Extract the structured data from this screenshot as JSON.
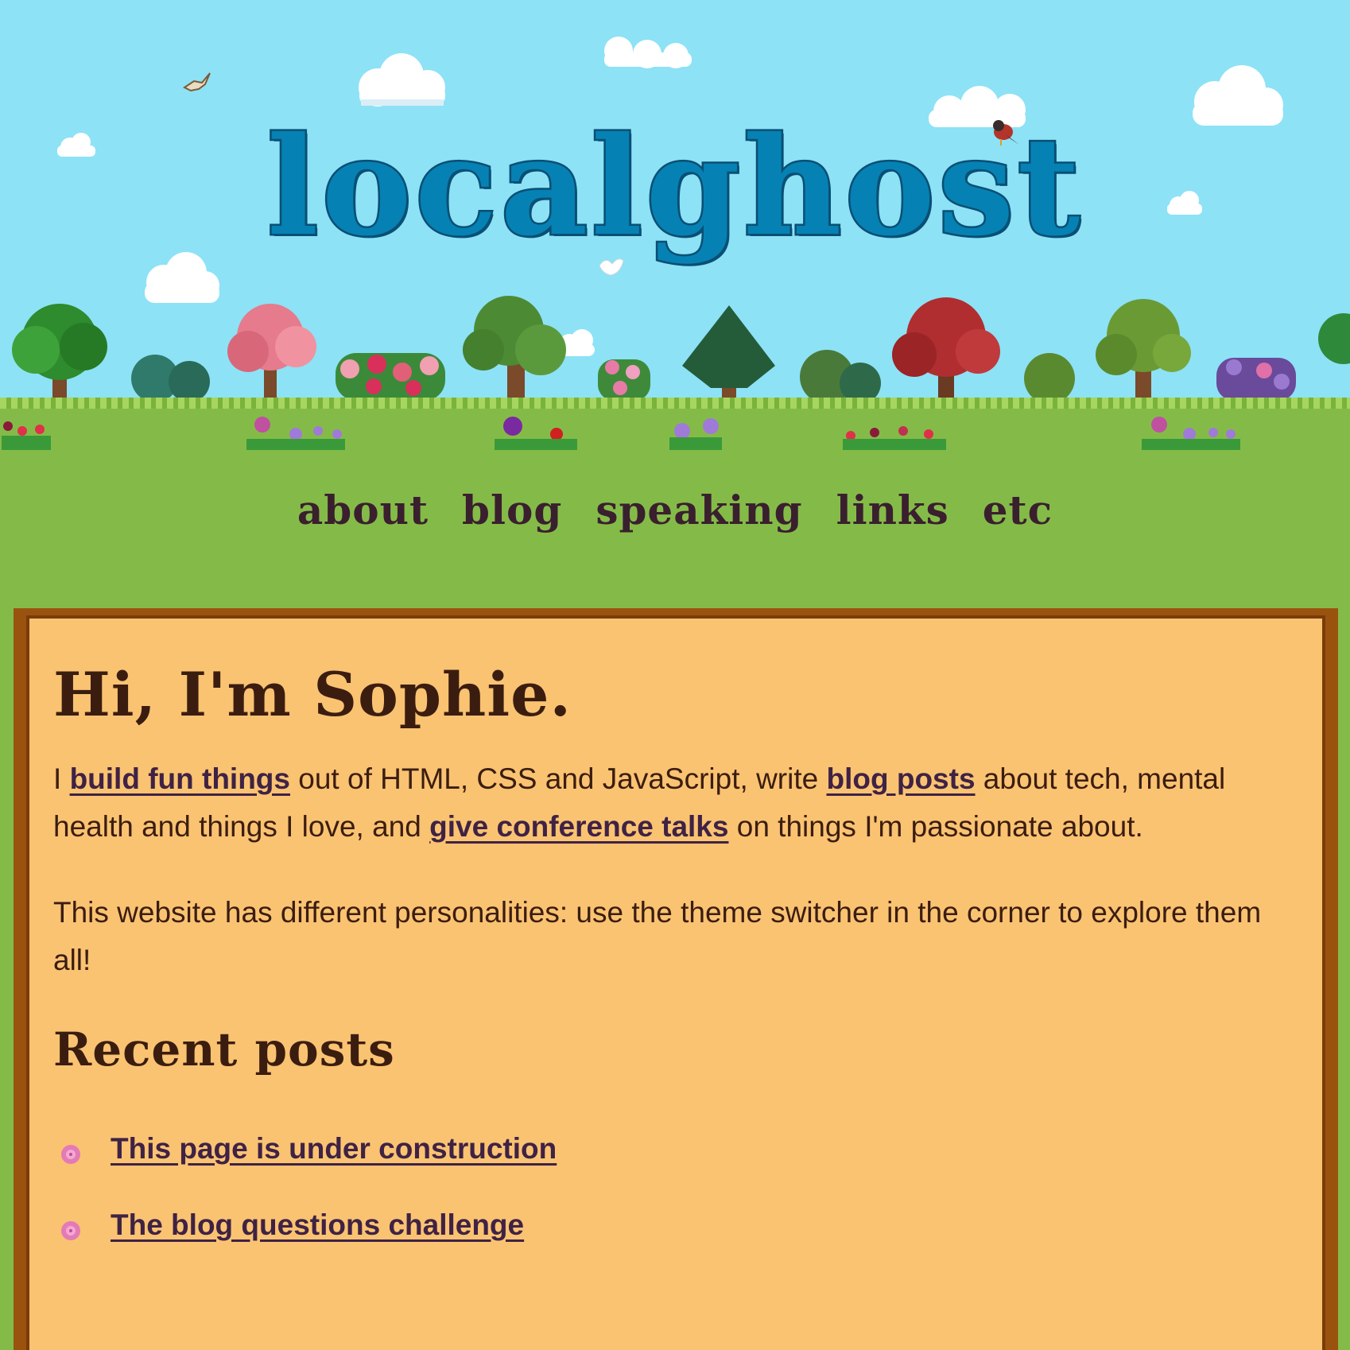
{
  "site": {
    "title": "localghost"
  },
  "nav": {
    "items": [
      {
        "label": "about"
      },
      {
        "label": "blog"
      },
      {
        "label": "speaking"
      },
      {
        "label": "links"
      },
      {
        "label": "etc"
      }
    ]
  },
  "intro": {
    "heading": "Hi, I'm Sophie.",
    "p1_before": "I ",
    "p1_link1": "build fun things",
    "p1_mid1": " out of HTML, CSS and JavaScript, write ",
    "p1_link2": "blog posts",
    "p1_mid2": " about tech, mental health and things I love, and ",
    "p1_link3": "give conference talks",
    "p1_after": " on things I'm passionate about.",
    "p2": "This website has different personalities: use the theme switcher in the corner to explore them all!"
  },
  "recent_posts": {
    "heading": "Recent posts",
    "items": [
      {
        "title": "This page is under construction"
      },
      {
        "title": "The blog questions challenge"
      }
    ]
  },
  "colors": {
    "sky": "#8de2f6",
    "grass": "#84bb48",
    "panel": "#fac372",
    "panel_border": "#9a530f",
    "title": "#0681b4",
    "text": "#3b1d10",
    "link": "#3f2244"
  },
  "icons": [
    "cloud-icon",
    "bird-icon",
    "tree-icon",
    "bush-icon",
    "flower-icon",
    "flower-bullet-icon"
  ]
}
